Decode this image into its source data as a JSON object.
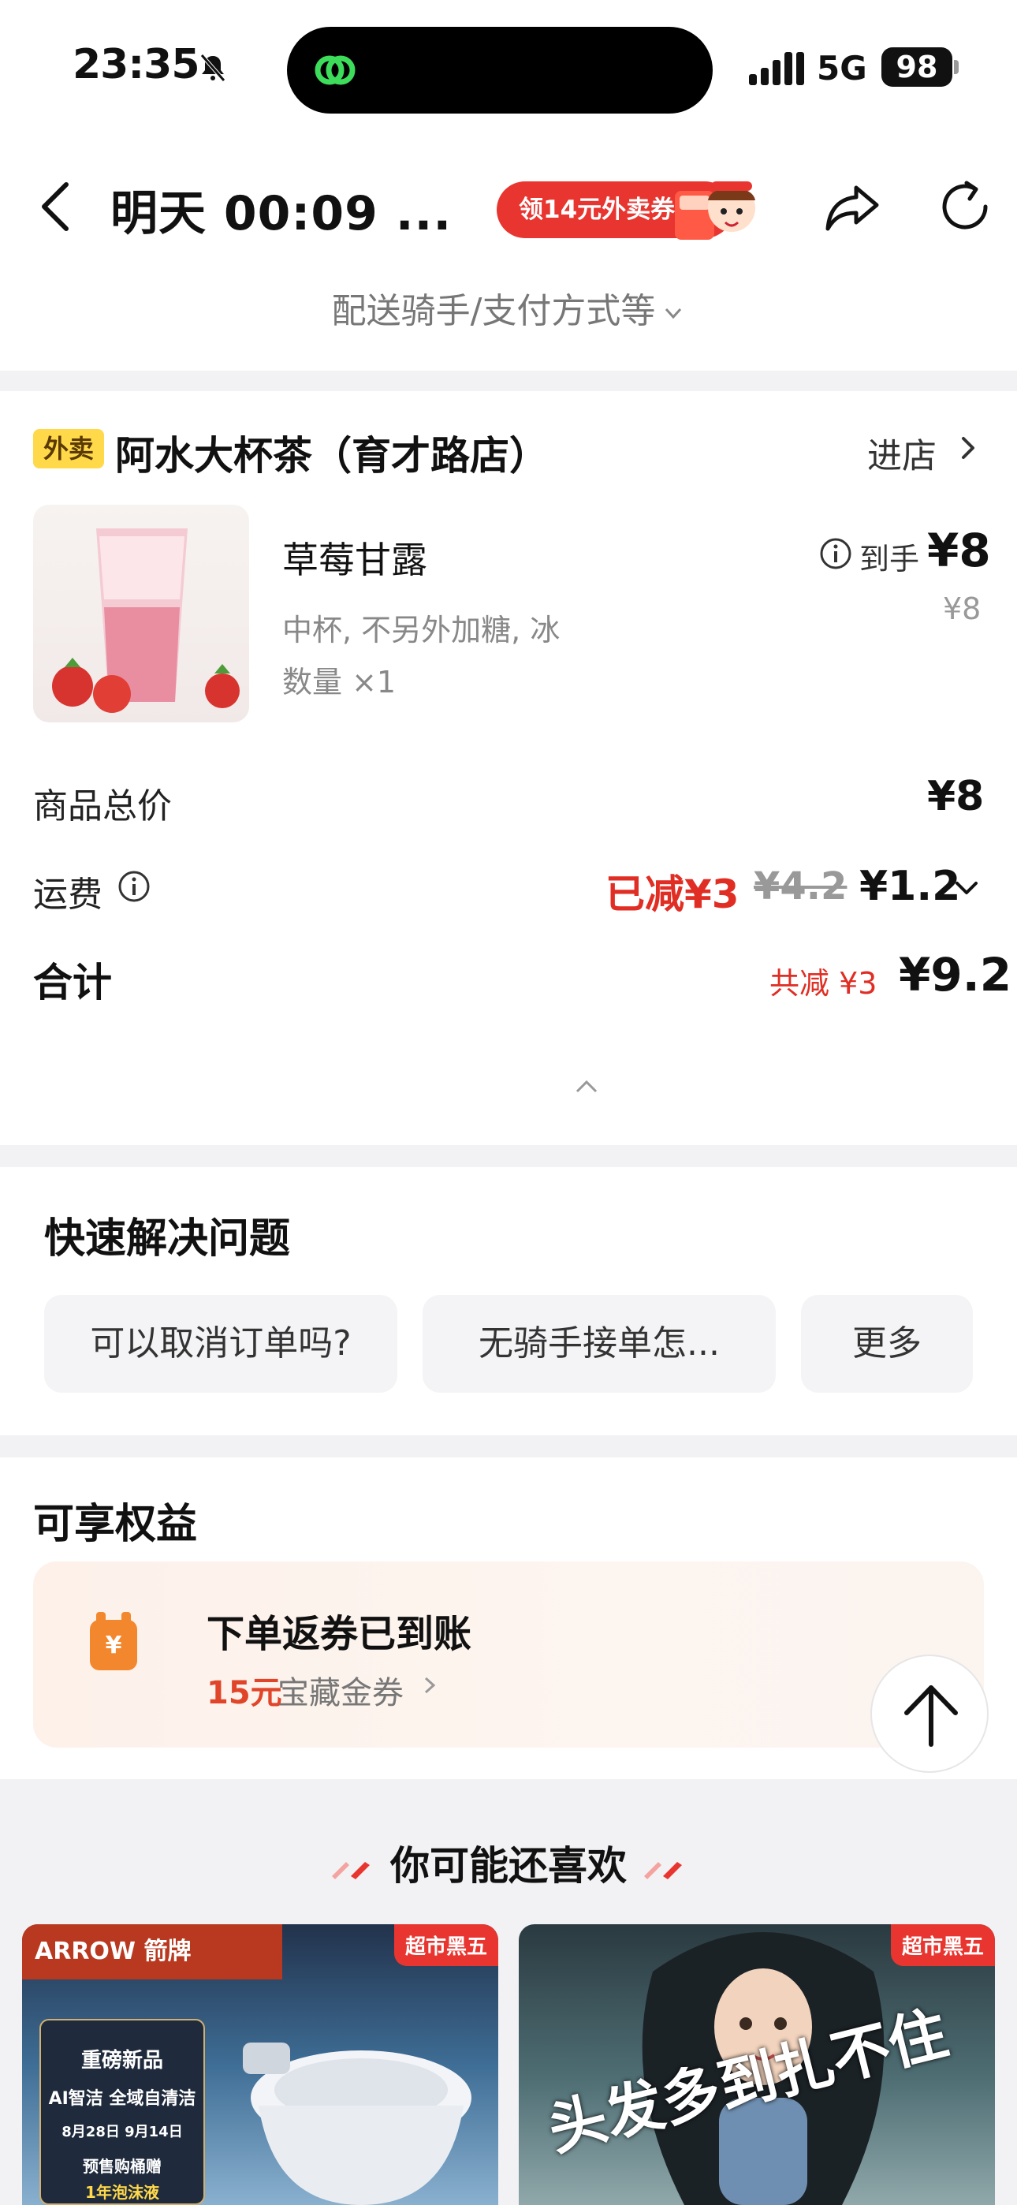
{
  "status_bar": {
    "time": "23:35",
    "network": "5G",
    "battery": "98"
  },
  "header": {
    "back_icon": "chevron-left-icon",
    "title": "明天 00:09 ...",
    "coupon_label": "领14元外卖券",
    "share_icon": "share-icon",
    "refresh_icon": "refresh-icon",
    "sub_link": "配送骑手/支付方式等"
  },
  "store": {
    "tag": "外卖",
    "name": "阿水大杯茶（育才路店）",
    "enter_label": "进店"
  },
  "product": {
    "name": "草莓甘露",
    "spec": "中杯, 不另外加糖, 冰",
    "qty": "数量 ×1",
    "price_label": "到手",
    "price": "¥8",
    "orig_price": "¥8"
  },
  "summary": {
    "goods_total_label": "商品总价",
    "goods_total": "¥8",
    "fee_label": "运费",
    "fee_saved": "已减¥3",
    "fee_original": "¥4.2",
    "fee_final": "¥1.2",
    "sum_label": "合计",
    "sum_saved": "共减 ¥3",
    "sum_value": "¥9.2"
  },
  "quick": {
    "title": "快速解决问题",
    "chips": [
      "可以取消订单吗?",
      "无骑手接单怎...",
      "更多"
    ]
  },
  "benefits": {
    "title": "可享权益",
    "headline": "下单返券已到账",
    "amount": "15元",
    "desc": "宝藏金券"
  },
  "recommend": {
    "title": "你可能还喜欢",
    "items": [
      {
        "badge": "超市黑五",
        "brand": "ARROW 箭牌",
        "lines": [
          "重磅新品",
          "AI智洁 全域自清洁",
          "8月28日  9月14日",
          "预售购桶赠",
          "1年泡沫液"
        ]
      },
      {
        "badge": "超市黑五",
        "slogan": "头发多到扎不住"
      }
    ]
  },
  "colors": {
    "accent_red": "#e02e24",
    "tag_yellow": "#ffd94a",
    "coupon_red": "#e8352f"
  }
}
